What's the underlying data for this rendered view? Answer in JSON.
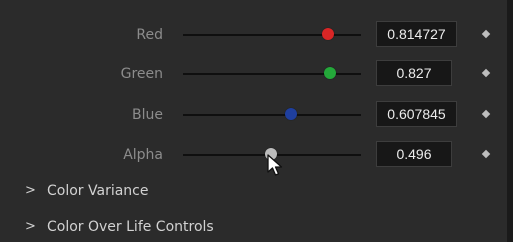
{
  "channels": [
    {
      "label": "Red",
      "value": "0.814727",
      "fraction": 0.814727,
      "color": "#d92626"
    },
    {
      "label": "Green",
      "value": "0.827",
      "fraction": 0.827,
      "color": "#24a83a"
    },
    {
      "label": "Blue",
      "value": "0.607845",
      "fraction": 0.607845,
      "color": "#1f3f9e"
    },
    {
      "label": "Alpha",
      "value": "0.496",
      "fraction": 0.496,
      "color": "#bdbdbd"
    }
  ],
  "sections": [
    {
      "label": "Color Variance",
      "icon": "chevron-right-icon"
    },
    {
      "label": "Color Over Life Controls",
      "icon": "chevron-right-icon"
    }
  ],
  "icons": {
    "keyframe": "diamond-icon",
    "pointer": "mouse-cursor-icon"
  },
  "colors": {
    "background": "#2b2b2b",
    "value_box": "#171717"
  }
}
